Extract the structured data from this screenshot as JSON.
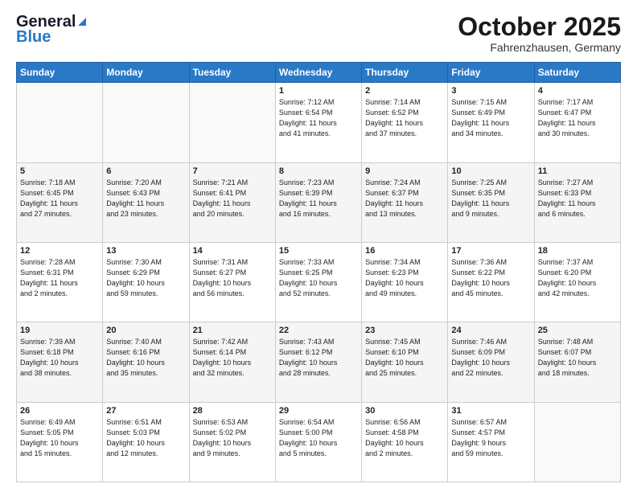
{
  "header": {
    "logo_line1": "General",
    "logo_line2": "Blue",
    "month": "October 2025",
    "location": "Fahrenzhausen, Germany"
  },
  "weekdays": [
    "Sunday",
    "Monday",
    "Tuesday",
    "Wednesday",
    "Thursday",
    "Friday",
    "Saturday"
  ],
  "weeks": [
    [
      {
        "day": "",
        "info": ""
      },
      {
        "day": "",
        "info": ""
      },
      {
        "day": "",
        "info": ""
      },
      {
        "day": "1",
        "info": "Sunrise: 7:12 AM\nSunset: 6:54 PM\nDaylight: 11 hours\nand 41 minutes."
      },
      {
        "day": "2",
        "info": "Sunrise: 7:14 AM\nSunset: 6:52 PM\nDaylight: 11 hours\nand 37 minutes."
      },
      {
        "day": "3",
        "info": "Sunrise: 7:15 AM\nSunset: 6:49 PM\nDaylight: 11 hours\nand 34 minutes."
      },
      {
        "day": "4",
        "info": "Sunrise: 7:17 AM\nSunset: 6:47 PM\nDaylight: 11 hours\nand 30 minutes."
      }
    ],
    [
      {
        "day": "5",
        "info": "Sunrise: 7:18 AM\nSunset: 6:45 PM\nDaylight: 11 hours\nand 27 minutes."
      },
      {
        "day": "6",
        "info": "Sunrise: 7:20 AM\nSunset: 6:43 PM\nDaylight: 11 hours\nand 23 minutes."
      },
      {
        "day": "7",
        "info": "Sunrise: 7:21 AM\nSunset: 6:41 PM\nDaylight: 11 hours\nand 20 minutes."
      },
      {
        "day": "8",
        "info": "Sunrise: 7:23 AM\nSunset: 6:39 PM\nDaylight: 11 hours\nand 16 minutes."
      },
      {
        "day": "9",
        "info": "Sunrise: 7:24 AM\nSunset: 6:37 PM\nDaylight: 11 hours\nand 13 minutes."
      },
      {
        "day": "10",
        "info": "Sunrise: 7:25 AM\nSunset: 6:35 PM\nDaylight: 11 hours\nand 9 minutes."
      },
      {
        "day": "11",
        "info": "Sunrise: 7:27 AM\nSunset: 6:33 PM\nDaylight: 11 hours\nand 6 minutes."
      }
    ],
    [
      {
        "day": "12",
        "info": "Sunrise: 7:28 AM\nSunset: 6:31 PM\nDaylight: 11 hours\nand 2 minutes."
      },
      {
        "day": "13",
        "info": "Sunrise: 7:30 AM\nSunset: 6:29 PM\nDaylight: 10 hours\nand 59 minutes."
      },
      {
        "day": "14",
        "info": "Sunrise: 7:31 AM\nSunset: 6:27 PM\nDaylight: 10 hours\nand 56 minutes."
      },
      {
        "day": "15",
        "info": "Sunrise: 7:33 AM\nSunset: 6:25 PM\nDaylight: 10 hours\nand 52 minutes."
      },
      {
        "day": "16",
        "info": "Sunrise: 7:34 AM\nSunset: 6:23 PM\nDaylight: 10 hours\nand 49 minutes."
      },
      {
        "day": "17",
        "info": "Sunrise: 7:36 AM\nSunset: 6:22 PM\nDaylight: 10 hours\nand 45 minutes."
      },
      {
        "day": "18",
        "info": "Sunrise: 7:37 AM\nSunset: 6:20 PM\nDaylight: 10 hours\nand 42 minutes."
      }
    ],
    [
      {
        "day": "19",
        "info": "Sunrise: 7:39 AM\nSunset: 6:18 PM\nDaylight: 10 hours\nand 38 minutes."
      },
      {
        "day": "20",
        "info": "Sunrise: 7:40 AM\nSunset: 6:16 PM\nDaylight: 10 hours\nand 35 minutes."
      },
      {
        "day": "21",
        "info": "Sunrise: 7:42 AM\nSunset: 6:14 PM\nDaylight: 10 hours\nand 32 minutes."
      },
      {
        "day": "22",
        "info": "Sunrise: 7:43 AM\nSunset: 6:12 PM\nDaylight: 10 hours\nand 28 minutes."
      },
      {
        "day": "23",
        "info": "Sunrise: 7:45 AM\nSunset: 6:10 PM\nDaylight: 10 hours\nand 25 minutes."
      },
      {
        "day": "24",
        "info": "Sunrise: 7:46 AM\nSunset: 6:09 PM\nDaylight: 10 hours\nand 22 minutes."
      },
      {
        "day": "25",
        "info": "Sunrise: 7:48 AM\nSunset: 6:07 PM\nDaylight: 10 hours\nand 18 minutes."
      }
    ],
    [
      {
        "day": "26",
        "info": "Sunrise: 6:49 AM\nSunset: 5:05 PM\nDaylight: 10 hours\nand 15 minutes."
      },
      {
        "day": "27",
        "info": "Sunrise: 6:51 AM\nSunset: 5:03 PM\nDaylight: 10 hours\nand 12 minutes."
      },
      {
        "day": "28",
        "info": "Sunrise: 6:53 AM\nSunset: 5:02 PM\nDaylight: 10 hours\nand 9 minutes."
      },
      {
        "day": "29",
        "info": "Sunrise: 6:54 AM\nSunset: 5:00 PM\nDaylight: 10 hours\nand 5 minutes."
      },
      {
        "day": "30",
        "info": "Sunrise: 6:56 AM\nSunset: 4:58 PM\nDaylight: 10 hours\nand 2 minutes."
      },
      {
        "day": "31",
        "info": "Sunrise: 6:57 AM\nSunset: 4:57 PM\nDaylight: 9 hours\nand 59 minutes."
      },
      {
        "day": "",
        "info": ""
      }
    ]
  ]
}
